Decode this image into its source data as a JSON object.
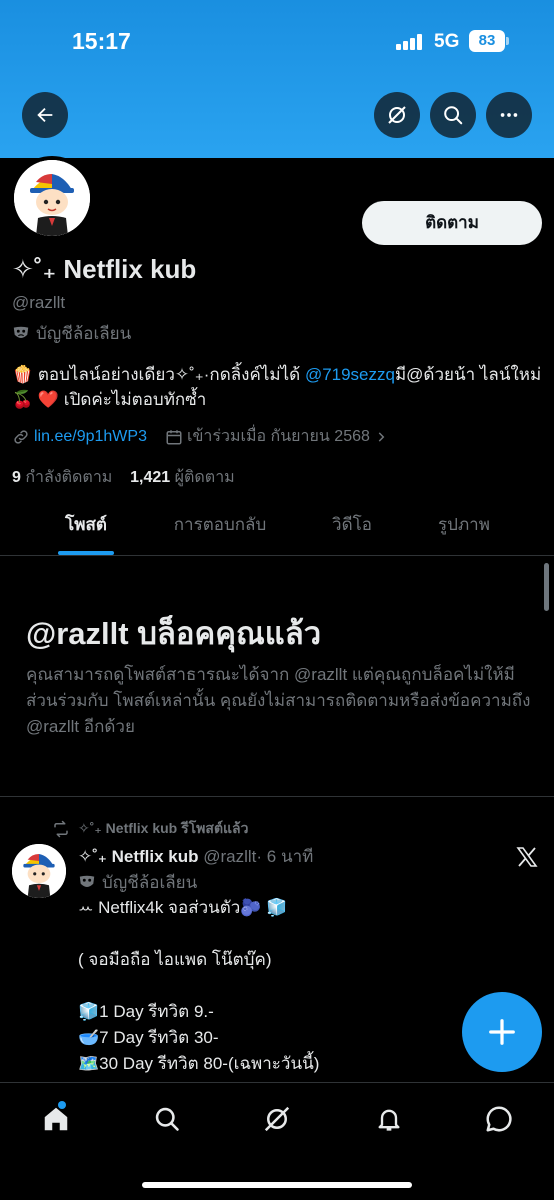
{
  "status_bar": {
    "time": "15:17",
    "network": "5G",
    "battery": "83"
  },
  "header": {
    "back_icon": "arrow-left-icon",
    "grok_icon": "grok-icon",
    "search_icon": "search-icon",
    "more_icon": "more-horizontal-icon"
  },
  "profile": {
    "follow_label": "ติดตาม",
    "display_name": "✧˚₊ Netflix kub",
    "handle": "@razllt",
    "parody_label": "บัญชีล้อเลียน",
    "bio_part1": "🍿 ตอบไลน์อย่างเดียว✧˚₊·กดลิ้งค์ไม่ได้ ",
    "bio_mention": "@719sezzq",
    "bio_part2": "มี@ด้วยน้า ไลน์ใหม่🍒 ❤️ เปิดค่ะไม่ตอบทักซ้ำ",
    "link": "lin.ee/9p1hWP3",
    "joined": "เข้าร่วมเมื่อ กันยายน 2568",
    "following_count": "9",
    "following_label": "กำลังติดตาม",
    "followers_count": "1,421",
    "followers_label": "ผู้ติดตาม"
  },
  "tabs": [
    {
      "label": "โพสต์",
      "active": true
    },
    {
      "label": "การตอบกลับ",
      "active": false
    },
    {
      "label": "วิดีโอ",
      "active": false
    },
    {
      "label": "รูปภาพ",
      "active": false
    }
  ],
  "blocked": {
    "title": "@razllt บล็อคคุณแล้ว",
    "message": "คุณสามารถดูโพสต์สาธารณะได้จาก @razllt แต่คุณถูกบล็อคไม่ให้มีส่วนร่วมกับ โพสต์เหล่านั้น คุณยังไม่สามารถติดตามหรือส่งข้อความถึง @razllt อีกด้วย"
  },
  "post": {
    "repost_label": "✧˚₊ Netflix kub รีโพสต์แล้ว",
    "author_name": "✧˚₊ Netflix kub",
    "author_handle": "@razllt",
    "time": "· 6 นาที",
    "parody_label": "บัญชีล้อเลียน",
    "lines": [
      "ꕀ Netflix4k จอส่วนตัว🫐 🧊",
      "",
      "( จอมือถือ ไอแพด โน๊ตบุ๊ค)",
      "",
      "🧊1 Day รีทวิต 9.-",
      "🥣7 Day รีทวิต 30-",
      "🗺️30 Day รีทวิต 80-(เฉพาะวันนี้)"
    ]
  },
  "fab": {
    "icon": "plus-icon"
  },
  "bottom_nav": [
    "home-icon",
    "search-icon",
    "grok-icon",
    "notifications-icon",
    "messages-icon"
  ],
  "colors": {
    "accent": "#1d9bf0",
    "banner": "#2aa3f0",
    "background": "#000000",
    "muted": "#71767b"
  }
}
